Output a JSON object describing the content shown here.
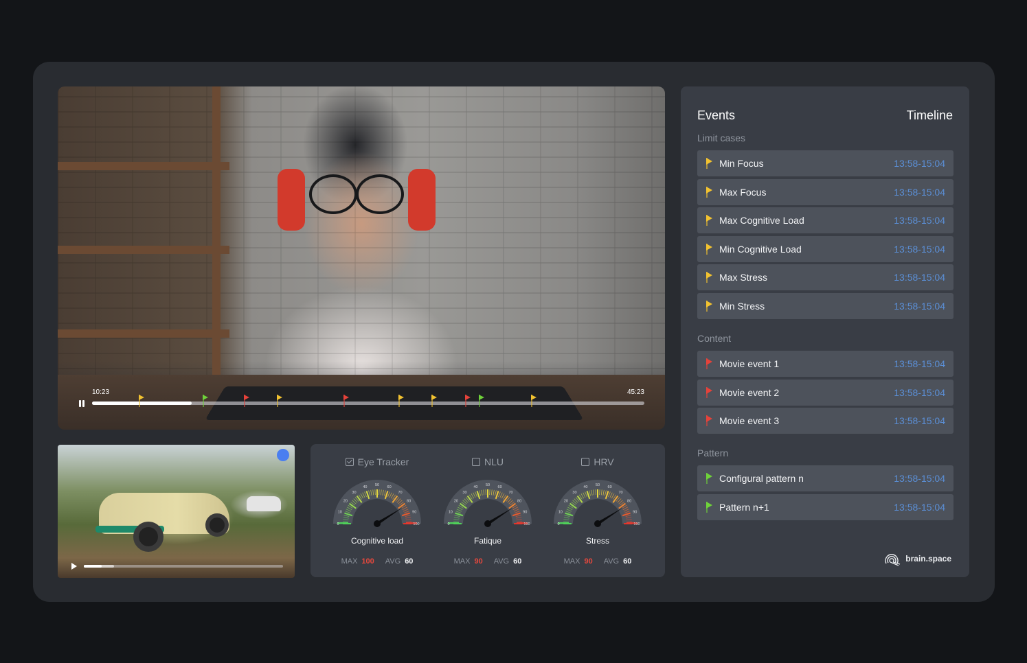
{
  "player": {
    "current_time": "10:23",
    "total_time": "45:23",
    "progress_percent": 18,
    "buffered_percent": 0,
    "play_state": "pause-icon",
    "markers": [
      {
        "position_percent": 8.5,
        "color": "#f2c230",
        "type": "limit-case"
      },
      {
        "position_percent": 20,
        "color": "#6fd23a",
        "type": "pattern"
      },
      {
        "position_percent": 27.5,
        "color": "#e6423a",
        "type": "content"
      },
      {
        "position_percent": 33.5,
        "color": "#f2c230",
        "type": "limit-case"
      },
      {
        "position_percent": 45.5,
        "color": "#e6423a",
        "type": "content"
      },
      {
        "position_percent": 55.5,
        "color": "#f2c230",
        "type": "limit-case"
      },
      {
        "position_percent": 61.5,
        "color": "#f2c230",
        "type": "limit-case"
      },
      {
        "position_percent": 67.5,
        "color": "#e6423a",
        "type": "content"
      },
      {
        "position_percent": 70,
        "color": "#6fd23a",
        "type": "pattern"
      },
      {
        "position_percent": 79.5,
        "color": "#f2c230",
        "type": "limit-case"
      }
    ]
  },
  "secondary_player": {
    "progress_percent": 9,
    "buffered_percent": 15,
    "play_state": "play-icon",
    "indicator_color": "#4a7ef0"
  },
  "gauges": [
    {
      "source": "Eye Tracker",
      "checked": true,
      "label": "Cognitive load",
      "value": 82,
      "max_label": "MAX",
      "max_value": "100",
      "avg_label": "AVG",
      "avg_value": "60",
      "scale": [
        "0",
        "10",
        "20",
        "30",
        "40",
        "50",
        "60",
        "70",
        "80",
        "90",
        "100"
      ]
    },
    {
      "source": "NLU",
      "checked": false,
      "label": "Fatique",
      "value": 82,
      "max_label": "MAX",
      "max_value": "90",
      "avg_label": "AVG",
      "avg_value": "60",
      "scale": [
        "0",
        "10",
        "20",
        "30",
        "40",
        "50",
        "60",
        "70",
        "80",
        "90",
        "100"
      ]
    },
    {
      "source": "HRV",
      "checked": false,
      "label": "Stress",
      "value": 82,
      "max_label": "MAX",
      "max_value": "90",
      "avg_label": "AVG",
      "avg_value": "60",
      "scale": [
        "0",
        "10",
        "20",
        "30",
        "40",
        "50",
        "60",
        "70",
        "80",
        "90",
        "100"
      ]
    }
  ],
  "events": {
    "title": "Events",
    "timeline_title": "Timeline",
    "sections": [
      {
        "label": "Limit cases",
        "flag_color": "#f2c230",
        "items": [
          {
            "name": "Min Focus",
            "time": "13:58-15:04"
          },
          {
            "name": "Max Focus",
            "time": "13:58-15:04"
          },
          {
            "name": "Max Cognitive Load",
            "time": "13:58-15:04"
          },
          {
            "name": "Min Cognitive Load",
            "time": "13:58-15:04"
          },
          {
            "name": "Max Stress",
            "time": "13:58-15:04"
          },
          {
            "name": "Min Stress",
            "time": "13:58-15:04"
          }
        ]
      },
      {
        "label": "Content",
        "flag_color": "#e6423a",
        "items": [
          {
            "name": "Movie event 1",
            "time": "13:58-15:04"
          },
          {
            "name": "Movie event 2",
            "time": "13:58-15:04"
          },
          {
            "name": "Movie event 3",
            "time": "13:58-15:04"
          }
        ]
      },
      {
        "label": "Pattern",
        "flag_color": "#6fd23a",
        "items": [
          {
            "name": "Configural pattern n",
            "time": "13:58-15:04"
          },
          {
            "name": "Pattern n+1",
            "time": "13:58-15:04"
          }
        ]
      }
    ]
  },
  "brand": {
    "name": "brain.space",
    "icon": "brain-space-logo-icon"
  }
}
